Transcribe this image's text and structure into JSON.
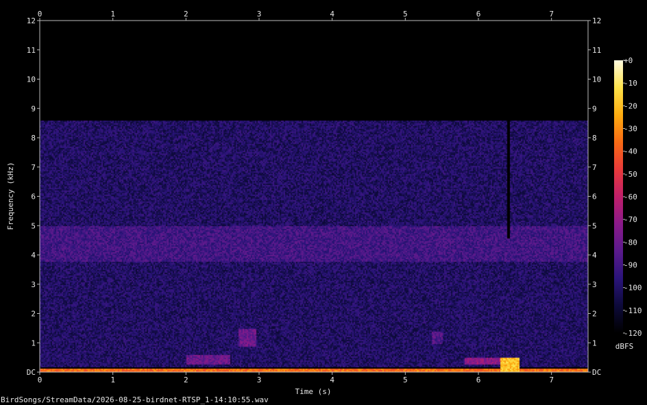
{
  "file_label": "BirdSongs/StreamData/2026-08-25-birdnet-RTSP_1-14:10:55.wav",
  "chart_data": {
    "type": "heatmap",
    "kind": "spectrogram",
    "xlabel": "Time (s)",
    "ylabel": "Frequency (kHz)",
    "xlim": [
      0,
      7.5
    ],
    "ylim": [
      0,
      12
    ],
    "x_ticks": [
      "0",
      "1",
      "2",
      "3",
      "4",
      "5",
      "6",
      "7"
    ],
    "y_ticks": [
      "DC",
      "1",
      "2",
      "3",
      "4",
      "5",
      "6",
      "7",
      "8",
      "9",
      "10",
      "11",
      "12"
    ],
    "colorbar": {
      "label": "dBFS",
      "range": [
        -120,
        0
      ],
      "ticks": [
        "+0",
        "-10",
        "-20",
        "-30",
        "-40",
        "-50",
        "-60",
        "-70",
        "-80",
        "-90",
        "-100",
        "-110",
        "-120"
      ],
      "colors": [
        "#000000",
        "#0d0a3a",
        "#2a147a",
        "#5a1a8c",
        "#8a1a8a",
        "#c01f6a",
        "#e83a3a",
        "#f86a14",
        "#fdac10",
        "#fde24a",
        "#fffbe0"
      ]
    },
    "features": [
      {
        "name": "background noise",
        "t": [
          0,
          7.5
        ],
        "f_khz": [
          0.2,
          8.6
        ],
        "level_dbfs": -100
      },
      {
        "name": "low-frequency band",
        "t": [
          0,
          7.5
        ],
        "f_khz": [
          0,
          0.15
        ],
        "level_dbfs": -35
      },
      {
        "name": "mid band",
        "t": [
          0,
          7.5
        ],
        "f_khz": [
          3.8,
          5.0
        ],
        "level_dbfs": -90
      },
      {
        "name": "dropout",
        "t": [
          6.38,
          6.42
        ],
        "f_khz": [
          4.6,
          8.6
        ],
        "level_dbfs": -120
      },
      {
        "name": "chirp",
        "t": [
          2.7,
          2.95
        ],
        "f_khz": [
          0.9,
          1.5
        ],
        "level_dbfs": -80
      },
      {
        "name": "chirp",
        "t": [
          5.8,
          6.3
        ],
        "f_khz": [
          0.3,
          0.5
        ],
        "level_dbfs": -70
      },
      {
        "name": "burst",
        "t": [
          6.3,
          6.55
        ],
        "f_khz": [
          0,
          0.5
        ],
        "level_dbfs": -20
      },
      {
        "name": "chirp",
        "t": [
          5.35,
          5.5
        ],
        "f_khz": [
          1.0,
          1.4
        ],
        "level_dbfs": -85
      },
      {
        "name": "chirp",
        "t": [
          2.0,
          2.6
        ],
        "f_khz": [
          0.3,
          0.6
        ],
        "level_dbfs": -80
      }
    ]
  }
}
